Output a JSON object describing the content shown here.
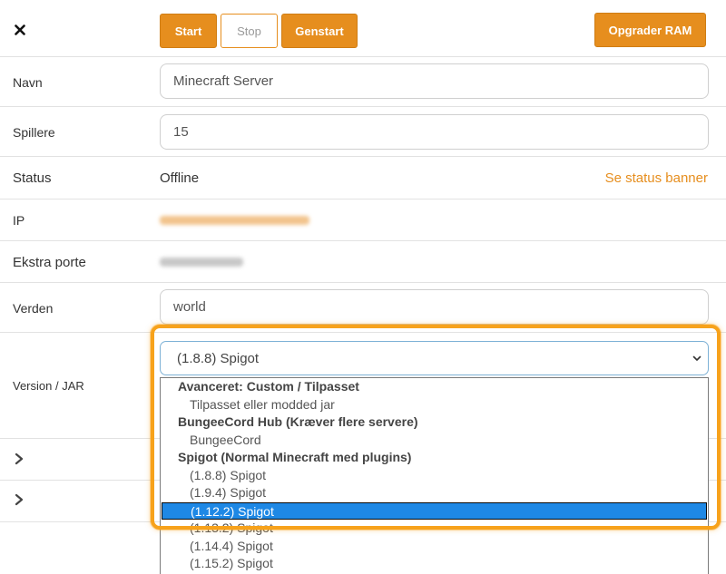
{
  "toolbar": {
    "start_label": "Start",
    "stop_label": "Stop",
    "restart_label": "Genstart",
    "upgrade_label": "Opgrader RAM",
    "close_icon": "close-icon"
  },
  "fields": {
    "name_label": "Navn",
    "name_value": "Minecraft Server",
    "players_label": "Spillere",
    "players_value": "15",
    "status_label": "Status",
    "status_value": "Offline",
    "status_banner_link": "Se status banner",
    "ip_label": "IP",
    "ports_label": "Ekstra porte",
    "world_label": "Verden",
    "world_value": "world",
    "version_label": "Version / JAR",
    "version_value": "(1.8.8) Spigot"
  },
  "dropdown": {
    "options": [
      {
        "label": "Avanceret: Custom / Tilpasset",
        "group": true
      },
      {
        "label": "Tilpasset eller modded jar"
      },
      {
        "label": "BungeeCord Hub (Kræver flere servere)",
        "group": true
      },
      {
        "label": "BungeeCord"
      },
      {
        "label": "Spigot (Normal Minecraft med plugins)",
        "group": true
      },
      {
        "label": "(1.8.8) Spigot"
      },
      {
        "label": "(1.9.4) Spigot"
      },
      {
        "label": "(1.12.2) Spigot",
        "selected": true
      },
      {
        "label": "(1.13.2) Spigot"
      },
      {
        "label": "(1.14.4) Spigot"
      },
      {
        "label": "(1.15.2) Spigot"
      }
    ]
  },
  "colors": {
    "accent": "#e68e1e",
    "selection": "#1e88e5",
    "highlight": "#f7a21b"
  }
}
